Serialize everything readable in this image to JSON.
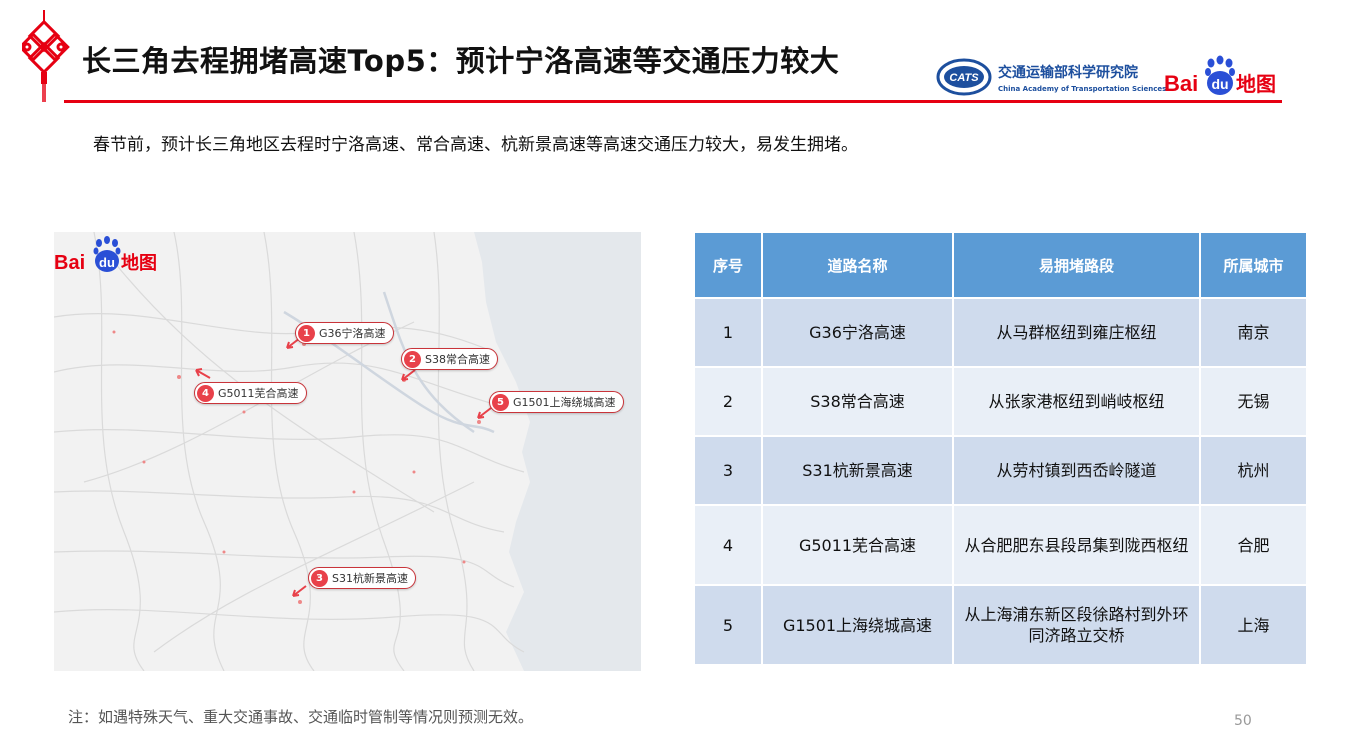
{
  "header": {
    "title": "长三角去程拥堵高速Top5：预计宁洛高速等交通压力较大",
    "accent_color": "#e60012",
    "org_logo_text": "CATS",
    "org_name_cn": "交通运输部科学研究院",
    "org_name_en": "China Academy of Transportation Sciences",
    "brand_logo_bai": "Bai",
    "brand_logo_du": "du",
    "brand_logo_map": "地图"
  },
  "intro": "春节前，预计长三角地区去程时宁洛高速、常合高速、杭新景高速等高速交通压力较大，易发生拥堵。",
  "map": {
    "logo_bai": "Bai",
    "logo_du": "du",
    "logo_map": "地图",
    "markers": [
      {
        "num": "1",
        "label": "G36宁洛高速"
      },
      {
        "num": "2",
        "label": "S38常合高速"
      },
      {
        "num": "3",
        "label": "S31杭新景高速"
      },
      {
        "num": "4",
        "label": "G5011芜合高速"
      },
      {
        "num": "5",
        "label": "G1501上海绕城高速"
      }
    ]
  },
  "table": {
    "header_color": "#5b9bd5",
    "columns": [
      "序号",
      "道路名称",
      "易拥堵路段",
      "所属城市"
    ],
    "rows": [
      [
        "1",
        "G36宁洛高速",
        "从马群枢纽到雍庄枢纽",
        "南京"
      ],
      [
        "2",
        "S38常合高速",
        "从张家港枢纽到峭岐枢纽",
        "无锡"
      ],
      [
        "3",
        "S31杭新景高速",
        "从劳村镇到西岙岭隧道",
        "杭州"
      ],
      [
        "4",
        "G5011芜合高速",
        "从合肥肥东县段昂集到陇西枢纽",
        "合肥"
      ],
      [
        "5",
        "G1501上海绕城高速",
        "从上海浦东新区段徐路村到外环同济路立交桥",
        "上海"
      ]
    ]
  },
  "note": "注：如遇特殊天气、重大交通事故、交通临时管制等情况则预测无效。",
  "page_number": "50"
}
